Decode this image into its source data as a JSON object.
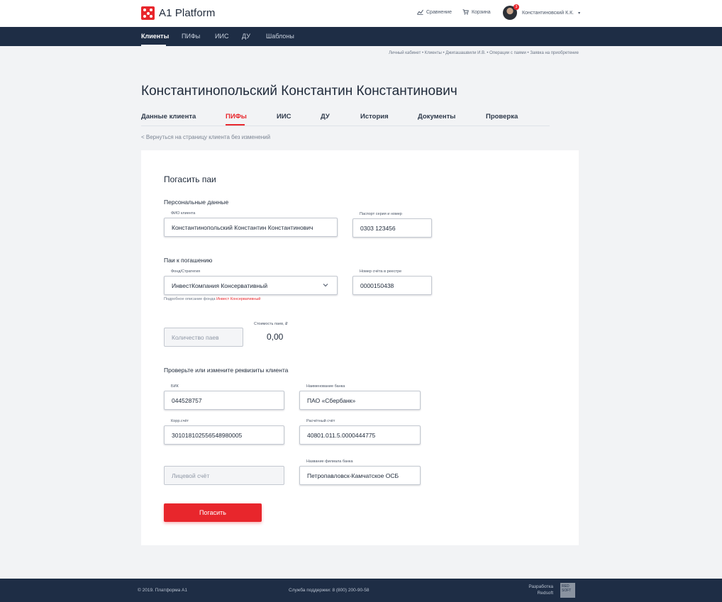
{
  "header": {
    "logo_text": "A1 Platform",
    "compare_label": "Сравнение",
    "cart_label": "Корзина",
    "user_name": "Константиновский К.К.",
    "notification_count": "3",
    "user_caret": "▾"
  },
  "nav": {
    "items": [
      {
        "label": "Клиенты"
      },
      {
        "label": "ПИФы"
      },
      {
        "label": "ИИС"
      },
      {
        "label": "ДУ"
      },
      {
        "label": "Шаблоны"
      }
    ]
  },
  "breadcrumb": "Личный кабинет • Клиенты • Джигашашвили И.В. • Операции с паями • Заявка на приобретение",
  "page_title": "Константинопольский Константин Константинович",
  "tabs": [
    {
      "label": "Данные клиента"
    },
    {
      "label": "ПИФы"
    },
    {
      "label": "ИИС"
    },
    {
      "label": "ДУ"
    },
    {
      "label": "История"
    },
    {
      "label": "Документы"
    },
    {
      "label": "Проверка"
    }
  ],
  "back_link": "< Вернуться на страницу клиента без изменений",
  "form": {
    "title": "Погасить паи",
    "personal_section": "Персональные данные",
    "fio_label": "ФИО клиента",
    "fio_value": "Константинопольский Константин Константинович",
    "passport_label": "Паспорт серия и номер",
    "passport_value": "0303 123456",
    "units_section": "Паи к погашению",
    "fund_label": "Фонд/Стратегия",
    "fund_value": "ИнвестКомпания Консервативный",
    "account_label": "Номер счёта в реестре",
    "account_value": "0000150438",
    "hint_prefix": "Подробное описание фонда",
    "hint_link": "Инвест Консервативный",
    "quantity_placeholder": "Количество паев",
    "cost_label": "Стоимость паев, ₽",
    "cost_value": "0,00",
    "bank_section": "Проверьте или измените реквизиты клиента",
    "bik_label": "БИК",
    "bik_value": "044528757",
    "bank_name_label": "Наименование банка",
    "bank_name_value": "ПАО «Сбербанк»",
    "corr_label": "Корр.счёт",
    "corr_value": "30101810255654898000​5",
    "settlement_label": "Расчётный счёт",
    "settlement_value": "40801.011.5.0000444775",
    "personal_account_placeholder": "Лицевой счёт",
    "branch_label": "Название филиала банка",
    "branch_value": "Петропавловск-Камчатское ОСБ",
    "submit_label": "Погасить"
  },
  "footer": {
    "copyright": "© 2019. Платформа А1",
    "support": "Служба поддержки:  8 (800) 200-90-58",
    "dev_line1": "Разработка",
    "dev_line2": "Redsoft",
    "badge": "RED SOFT"
  },
  "colors": {
    "accent": "#e8262c",
    "navy": "#1e2d45",
    "background": "#f2f3f5"
  }
}
